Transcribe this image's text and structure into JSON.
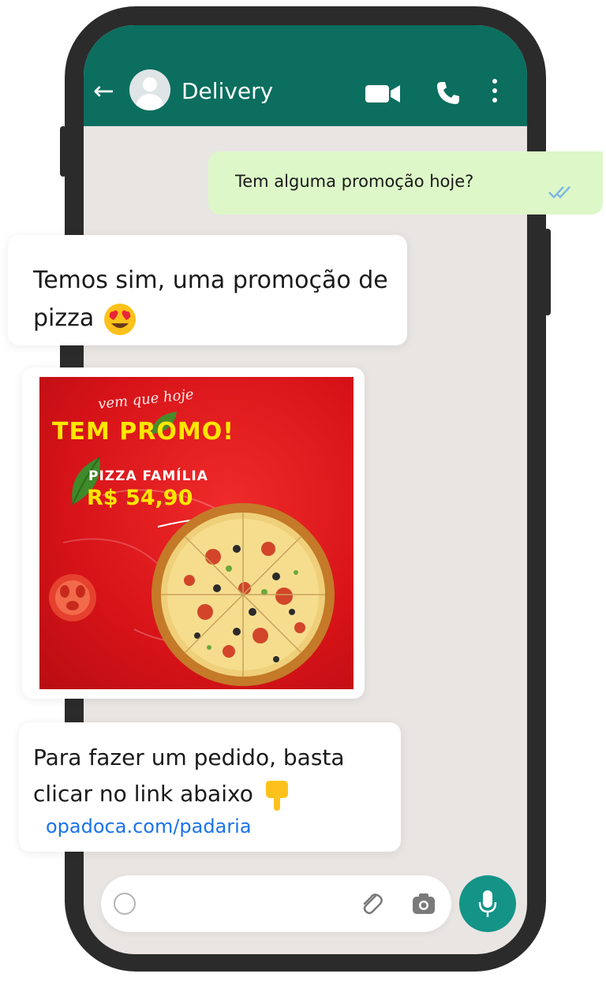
{
  "chat": {
    "contact_name": "Delivery",
    "icons": {
      "back": "back-arrow-icon",
      "avatar": "avatar-icon",
      "video": "video-call-icon",
      "call": "phone-icon",
      "menu": "more-options-icon"
    }
  },
  "messages": {
    "outgoing_1": {
      "text": "Tem alguma promoção hoje?",
      "status_icon": "read-ticks-icon"
    },
    "incoming_1": {
      "text": "Temos sim, uma promoção de pizza",
      "emoji": "heart-eyes-emoji"
    },
    "incoming_image": {
      "script_text": "vem que hoje",
      "headline": "TEM PROMO!",
      "product": "PIZZA FAMÍLIA",
      "price": "R$ 54,90"
    },
    "incoming_2": {
      "text": "Para fazer um pedido, basta clicar no link abaixo",
      "emoji": "pointing-down-emoji",
      "link": "opadoca.com/padaria"
    }
  },
  "input_bar": {
    "icons": {
      "emoji": "emoji-icon",
      "attach": "paperclip-icon",
      "camera": "camera-icon",
      "mic": "microphone-icon"
    }
  },
  "colors": {
    "header": "#0b6e5e",
    "chat_background": "#e9e5e3",
    "outgoing_bubble": "#ddf7c8",
    "link": "#1a73e8",
    "mic_button": "#139487",
    "promo_red": "#d61318",
    "promo_yellow": "#ffe600"
  }
}
